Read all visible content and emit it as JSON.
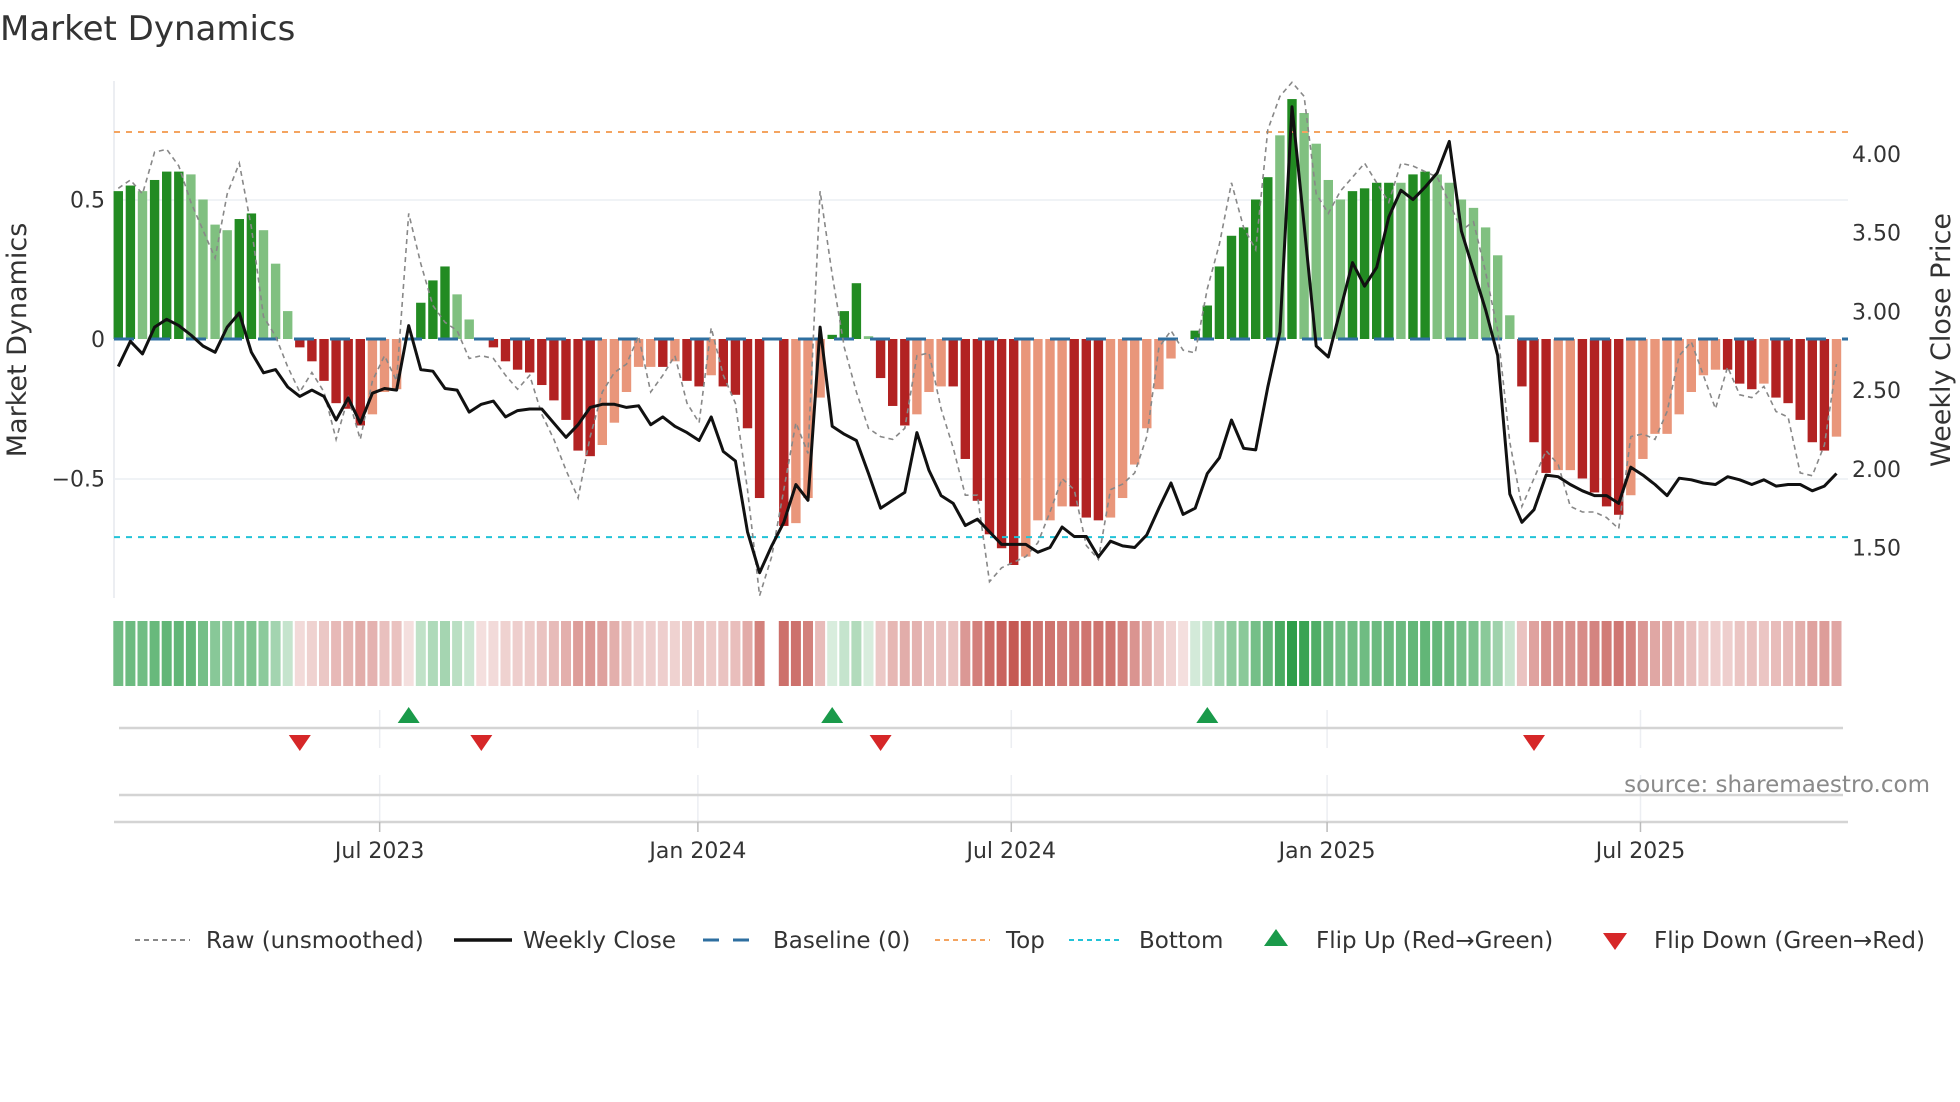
{
  "title": "Market Dynamics",
  "source": "source: sharemaestro.com",
  "colors": {
    "strong_green": "#228b22",
    "weak_green": "#80c080",
    "strong_red": "#b22222",
    "weak_red": "#e9967a",
    "heat_green": "#2e9e4a",
    "heat_red": "#c2504a",
    "raw": "#888888",
    "close": "#111111",
    "baseline": "#2e6fa0",
    "top": "#f4a460",
    "bottom": "#22c3d8",
    "flip_up": "#1a9a4a",
    "flip_down": "#d62728"
  },
  "chart_data": {
    "type": "bar",
    "title": "Market Dynamics",
    "ylabel": "Market Dynamics",
    "y2label": "Weekly Close Price",
    "ylim": [
      -0.94,
      0.92
    ],
    "y2lim": [
      1.18,
      4.46
    ],
    "yticks": [
      {
        "v": 0.5,
        "label": "0.5"
      },
      {
        "v": 0,
        "label": "0"
      },
      {
        "v": -0.5,
        "label": "−0.5"
      }
    ],
    "y2ticks": [
      {
        "v": 4.0,
        "label": "4.00"
      },
      {
        "v": 3.5,
        "label": "3.50"
      },
      {
        "v": 3.0,
        "label": "3.00"
      },
      {
        "v": 2.5,
        "label": "2.50"
      },
      {
        "v": 2.0,
        "label": "2.00"
      },
      {
        "v": 1.5,
        "label": "1.50"
      }
    ],
    "x_unit": "week index",
    "xticks": [
      {
        "week": 21.6,
        "label": "Jul 2023"
      },
      {
        "week": 47.9,
        "label": "Jan 2024"
      },
      {
        "week": 73.8,
        "label": "Jul 2024"
      },
      {
        "week": 99.9,
        "label": "Jan 2025"
      },
      {
        "week": 125.8,
        "label": "Jul 2025"
      }
    ],
    "top_level": 0.742,
    "bottom_level": -0.71,
    "baseline": 0,
    "momentum": [
      0.53,
      0.55,
      0.53,
      0.57,
      0.6,
      0.6,
      0.59,
      0.5,
      0.41,
      0.39,
      0.43,
      0.45,
      0.39,
      0.27,
      0.1,
      -0.03,
      -0.08,
      -0.15,
      -0.23,
      -0.25,
      -0.31,
      -0.27,
      -0.19,
      -0.18,
      0,
      0.13,
      0.21,
      0.26,
      0.16,
      0.07,
      0,
      -0.03,
      -0.08,
      -0.11,
      -0.12,
      -0.165,
      -0.22,
      -0.29,
      -0.4,
      -0.42,
      -0.38,
      -0.3,
      -0.19,
      -0.1,
      -0.1,
      -0.1,
      -0.08,
      -0.15,
      -0.17,
      -0.13,
      -0.17,
      -0.2,
      -0.32,
      -0.57,
      null,
      -0.67,
      -0.66,
      -0.57,
      -0.21,
      0.015,
      0.1,
      0.2,
      0.01,
      -0.14,
      -0.24,
      -0.31,
      -0.27,
      -0.19,
      -0.17,
      -0.17,
      -0.43,
      -0.58,
      -0.7,
      -0.75,
      -0.81,
      -0.78,
      -0.65,
      -0.65,
      -0.6,
      -0.6,
      -0.64,
      -0.65,
      -0.64,
      -0.57,
      -0.45,
      -0.32,
      -0.18,
      -0.07,
      0,
      0.03,
      0.12,
      0.26,
      0.37,
      0.4,
      0.5,
      0.58,
      0.73,
      0.86,
      0.81,
      0.7,
      0.57,
      0.5,
      0.53,
      0.54,
      0.56,
      0.56,
      0.56,
      0.59,
      0.6,
      0.59,
      0.56,
      0.5,
      0.47,
      0.4,
      0.3,
      0.085,
      -0.17,
      -0.37,
      -0.48,
      -0.47,
      -0.47,
      -0.5,
      -0.55,
      -0.6,
      -0.63,
      -0.56,
      -0.43,
      -0.34,
      -0.34,
      -0.27,
      -0.19,
      -0.13,
      -0.11,
      -0.11,
      -0.16,
      -0.18,
      -0.16,
      -0.21,
      -0.23,
      -0.29,
      -0.37,
      -0.4,
      -0.35
    ],
    "strong": [
      1,
      1,
      0,
      1,
      1,
      1,
      0,
      0,
      0,
      0,
      1,
      1,
      0,
      0,
      0,
      1,
      1,
      1,
      1,
      1,
      1,
      0,
      0,
      0,
      0,
      1,
      1,
      1,
      0,
      0,
      0,
      1,
      1,
      1,
      1,
      1,
      1,
      1,
      1,
      1,
      0,
      0,
      0,
      0,
      0,
      1,
      0,
      1,
      1,
      0,
      1,
      1,
      1,
      1,
      0,
      1,
      0,
      0,
      0,
      1,
      1,
      1,
      0,
      1,
      1,
      1,
      0,
      0,
      0,
      1,
      1,
      1,
      1,
      1,
      1,
      0,
      0,
      0,
      0,
      1,
      1,
      1,
      0,
      0,
      0,
      0,
      0,
      0,
      0,
      1,
      1,
      1,
      1,
      1,
      1,
      1,
      0,
      1,
      0,
      0,
      0,
      0,
      1,
      1,
      1,
      1,
      0,
      1,
      1,
      0,
      0,
      0,
      0,
      0,
      0,
      0,
      1,
      1,
      1,
      0,
      0,
      1,
      1,
      1,
      1,
      0,
      0,
      0,
      0,
      0,
      0,
      0,
      0,
      1,
      1,
      1,
      0,
      1,
      1,
      1,
      1,
      1,
      0
    ],
    "raw": [
      0.54,
      0.57,
      0.52,
      0.67,
      0.68,
      0.62,
      0.49,
      0.39,
      0.29,
      0.52,
      0.63,
      0.4,
      0.08,
      0.01,
      -0.1,
      -0.19,
      -0.12,
      -0.19,
      -0.36,
      -0.21,
      -0.36,
      -0.15,
      -0.06,
      -0.15,
      0.45,
      0.27,
      0.12,
      0.06,
      0.03,
      -0.07,
      -0.06,
      -0.07,
      -0.13,
      -0.18,
      -0.13,
      -0.27,
      -0.36,
      -0.47,
      -0.57,
      -0.35,
      -0.19,
      -0.12,
      -0.09,
      0.01,
      -0.19,
      -0.13,
      -0.06,
      -0.23,
      -0.3,
      0.04,
      -0.13,
      -0.23,
      -0.54,
      -0.92,
      -0.78,
      -0.54,
      -0.3,
      -0.41,
      0.53,
      0.23,
      -0.03,
      -0.19,
      -0.32,
      -0.35,
      -0.36,
      -0.32,
      -0.06,
      -0.05,
      -0.25,
      -0.39,
      -0.56,
      -0.56,
      -0.87,
      -0.82,
      -0.8,
      -0.78,
      -0.73,
      -0.62,
      -0.5,
      -0.54,
      -0.74,
      -0.79,
      -0.54,
      -0.52,
      -0.48,
      -0.35,
      -0.03,
      0.03,
      -0.04,
      -0.05,
      0.18,
      0.34,
      0.56,
      0.4,
      0.32,
      0.75,
      0.87,
      0.92,
      0.87,
      0.52,
      0.45,
      0.53,
      0.58,
      0.63,
      0.56,
      0.49,
      0.63,
      0.62,
      0.6,
      0.58,
      0.49,
      0.39,
      0.42,
      0.24,
      0.03,
      -0.37,
      -0.6,
      -0.5,
      -0.4,
      -0.45,
      -0.6,
      -0.62,
      -0.62,
      -0.64,
      -0.68,
      -0.35,
      -0.34,
      -0.36,
      -0.26,
      -0.06,
      -0.01,
      -0.13,
      -0.25,
      -0.1,
      -0.2,
      -0.21,
      -0.17,
      -0.26,
      -0.28,
      -0.48,
      -0.49,
      -0.38,
      -0.09
    ],
    "close": [
      2.65,
      2.81,
      2.73,
      2.9,
      2.95,
      2.91,
      2.85,
      2.78,
      2.74,
      2.9,
      2.99,
      2.74,
      2.61,
      2.63,
      2.52,
      2.46,
      2.5,
      2.46,
      2.31,
      2.45,
      2.29,
      2.48,
      2.51,
      2.5,
      2.91,
      2.63,
      2.62,
      2.51,
      2.5,
      2.36,
      2.41,
      2.43,
      2.33,
      2.37,
      2.38,
      2.38,
      2.29,
      2.2,
      2.28,
      2.39,
      2.41,
      2.41,
      2.39,
      2.4,
      2.28,
      2.33,
      2.27,
      2.23,
      2.18,
      2.33,
      2.11,
      2.05,
      1.6,
      1.34,
      1.51,
      1.66,
      1.9,
      1.8,
      2.9,
      2.27,
      2.22,
      2.18,
      1.97,
      1.75,
      1.8,
      1.85,
      2.23,
      1.99,
      1.83,
      1.78,
      1.64,
      1.68,
      1.6,
      1.52,
      1.52,
      1.52,
      1.47,
      1.5,
      1.63,
      1.57,
      1.57,
      1.44,
      1.54,
      1.51,
      1.5,
      1.58,
      1.75,
      1.91,
      1.71,
      1.75,
      1.97,
      2.07,
      2.31,
      2.13,
      2.12,
      2.52,
      2.87,
      4.3,
      3.55,
      2.78,
      2.71,
      3.01,
      3.31,
      3.16,
      3.28,
      3.6,
      3.77,
      3.71,
      3.79,
      3.88,
      4.08,
      3.51,
      3.26,
      3.01,
      2.72,
      1.84,
      1.66,
      1.74,
      1.96,
      1.95,
      1.9,
      1.86,
      1.83,
      1.83,
      1.78,
      2.01,
      1.96,
      1.9,
      1.83,
      1.94,
      1.93,
      1.91,
      1.9,
      1.95,
      1.93,
      1.9,
      1.93,
      1.89,
      1.9,
      1.9,
      1.86,
      1.89,
      1.97
    ],
    "flip_up_weeks": [
      24,
      59,
      90
    ],
    "flip_down_weeks": [
      15,
      30,
      63,
      117
    ],
    "legend": {
      "placement": "bottom",
      "raw": "Raw (unsmoothed)",
      "close": "Weekly Close",
      "baseline": "Baseline (0)",
      "top": "Top",
      "bottom": "Bottom",
      "flip_up": "Flip Up (Red→Green)",
      "flip_down": "Flip Down (Green→Red)"
    }
  }
}
